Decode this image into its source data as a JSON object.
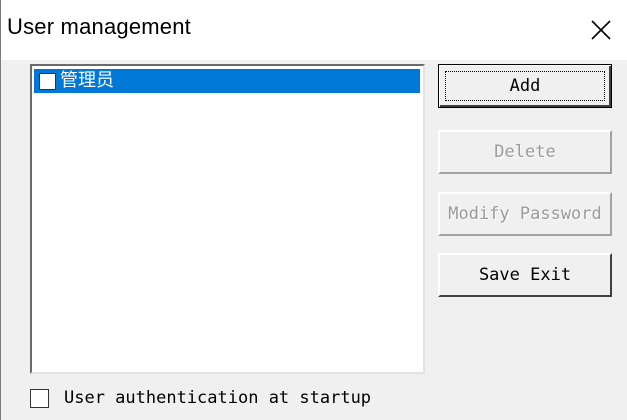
{
  "window": {
    "title": "User management"
  },
  "user_list": {
    "items": [
      {
        "label": "管理员",
        "checked": false,
        "selected": true
      }
    ]
  },
  "buttons": {
    "add": "Add",
    "delete": "Delete",
    "modify_password": "Modify Password",
    "save_exit": "Save Exit"
  },
  "auth": {
    "label": "User authentication at startup",
    "checked": false
  },
  "colors": {
    "selection": "#0078d7",
    "dialog_bg": "#f0f0f0",
    "disabled_text": "#9a9a9a"
  },
  "icons": {
    "close": "close-icon"
  }
}
